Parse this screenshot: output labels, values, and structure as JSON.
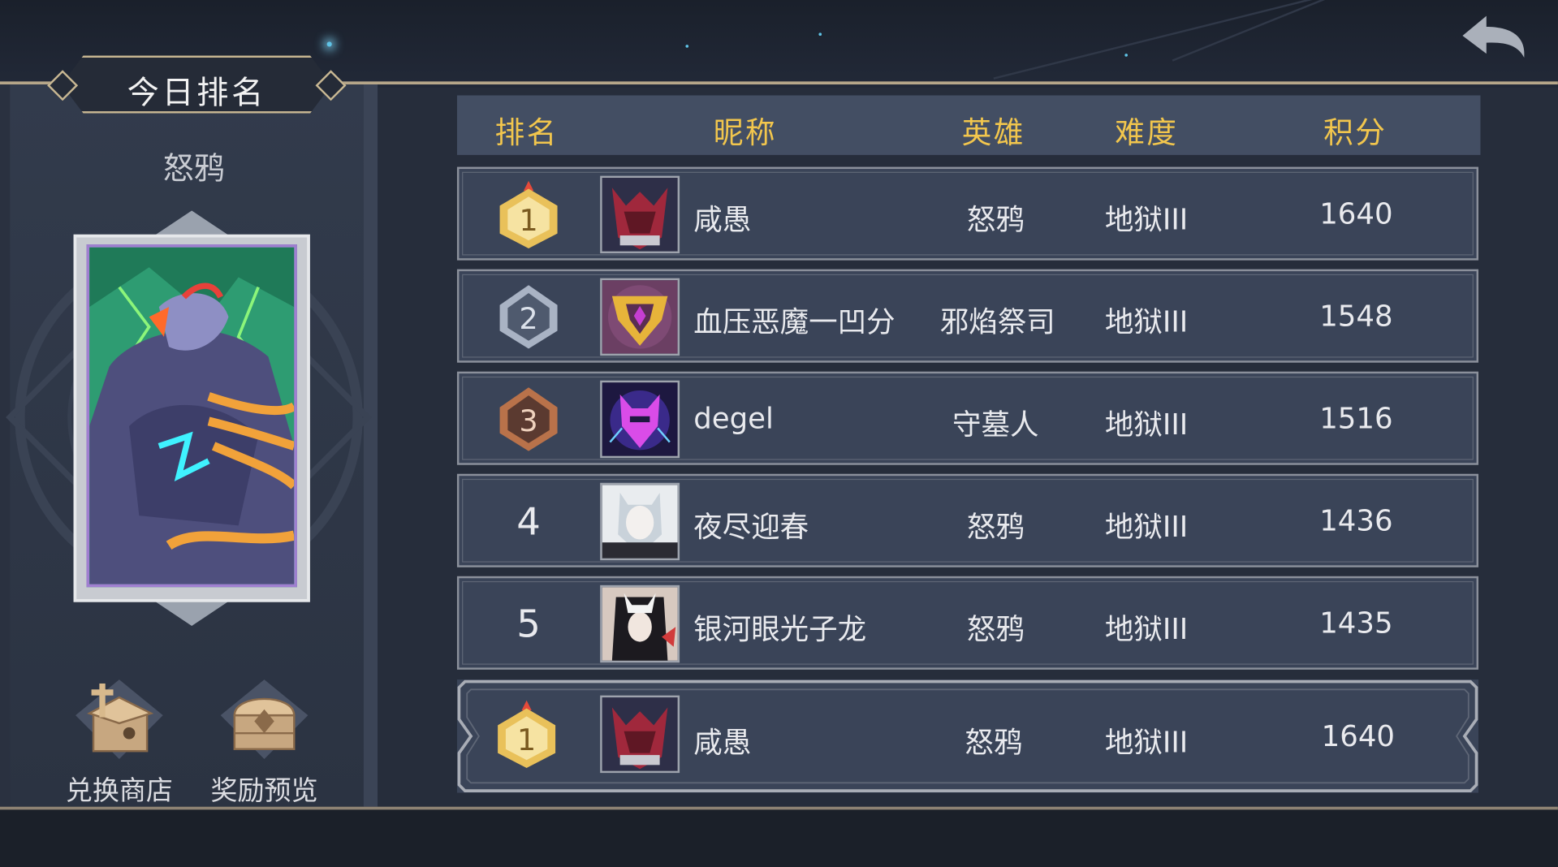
{
  "panel": {
    "title": "今日排名",
    "hero_name": "怒鸦"
  },
  "buttons": {
    "shop_label": "兑换商店",
    "rewards_label": "奖励预览"
  },
  "table": {
    "headers": {
      "rank": "排名",
      "nickname": "昵称",
      "hero": "英雄",
      "difficulty": "难度",
      "score": "积分"
    },
    "rows": [
      {
        "rank": "1",
        "name": "咸愚",
        "hero": "怒鸦",
        "difficulty": "地狱III",
        "score": "1640"
      },
      {
        "rank": "2",
        "name": "血压恶魔一凹分",
        "hero": "邪焰祭司",
        "difficulty": "地狱III",
        "score": "1548"
      },
      {
        "rank": "3",
        "name": "degel",
        "hero": "守墓人",
        "difficulty": "地狱III",
        "score": "1516"
      },
      {
        "rank": "4",
        "name": "夜尽迎春",
        "hero": "怒鸦",
        "difficulty": "地狱III",
        "score": "1436"
      },
      {
        "rank": "5",
        "name": "银河眼光子龙",
        "hero": "怒鸦",
        "difficulty": "地狱III",
        "score": "1435"
      }
    ],
    "my_row": {
      "rank": "1",
      "name": "咸愚",
      "hero": "怒鸦",
      "difficulty": "地狱III",
      "score": "1640"
    }
  },
  "colors": {
    "header_text": "#f2c64d",
    "gold_medal": "#e9c15a",
    "silver_medal": "#a9b3c4",
    "bronze_medal": "#b9724a"
  },
  "icons": {
    "back": "back-arrow-icon",
    "shop": "treasure-box-icon",
    "rewards": "treasure-chest-icon"
  }
}
